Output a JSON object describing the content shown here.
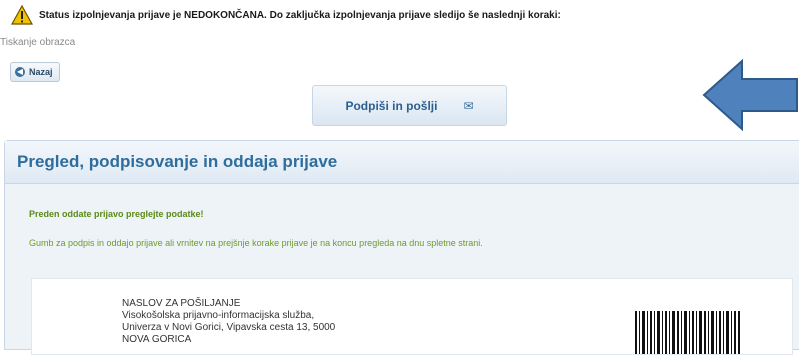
{
  "status": {
    "icon": "warning-icon",
    "text": "Status izpolnjevanja prijave je NEDOKONČANA. Do zaključka izpolnjevanja prijave sledijo še naslednji koraki:"
  },
  "print_label": "Tiskanje obrazca",
  "back_button": {
    "label": "Nazaj",
    "icon": "back-arrow-icon"
  },
  "sign_button": {
    "label": "Podpiši in pošlji",
    "icon": "mail-icon"
  },
  "annotation": {
    "icon": "arrow-left-icon",
    "color": "#4f81bd"
  },
  "panel": {
    "title": "Pregled, podpisovanje in oddaja prijave",
    "note_bold": "Preden oddate prijavo preglejte podatke!",
    "note_text": "Gumb za podpis in oddajo prijave ali vrnitev na prejšnje korake prijave je na koncu pregleda na dnu spletne strani."
  },
  "document": {
    "address_lines": [
      "NASLOV ZA POŠILJANJE",
      "Visokošolska prijavno-informacijska služba,",
      "Univerza v Novi Gorici, Vipavska cesta 13, 5000",
      "NOVA GORICA"
    ]
  },
  "colors": {
    "title_blue": "#2f6d9c",
    "note_green": "#5c8a18",
    "panel_bg": "#eef3f8"
  }
}
